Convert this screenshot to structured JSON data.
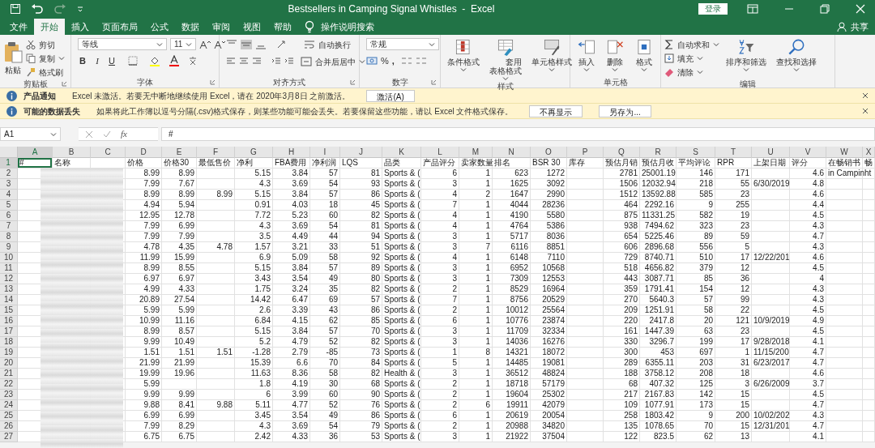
{
  "title_bar": {
    "title": "Bestsellers in Camping Signal Whistles  -  Excel",
    "sign_in": "登录"
  },
  "menu_tabs": [
    {
      "label": "文件",
      "selected": false
    },
    {
      "label": "开始",
      "selected": true
    },
    {
      "label": "插入",
      "selected": false
    },
    {
      "label": "页面布局",
      "selected": false
    },
    {
      "label": "公式",
      "selected": false
    },
    {
      "label": "数据",
      "selected": false
    },
    {
      "label": "审阅",
      "selected": false
    },
    {
      "label": "视图",
      "selected": false
    },
    {
      "label": "帮助",
      "selected": false
    }
  ],
  "tell_me": "操作说明搜索",
  "share": "共享",
  "ribbon": {
    "clipboard": {
      "paste": "粘贴",
      "cut": "剪切",
      "copy": "复制",
      "format_painter": "格式刷",
      "label": "剪贴板"
    },
    "font": {
      "font_name": "等线",
      "font_size": "11",
      "bold": "B",
      "italic": "I",
      "underline": "U",
      "label": "字体"
    },
    "alignment": {
      "wrap_text": "自动换行",
      "merge_center": "合并后居中",
      "label": "对齐方式"
    },
    "number": {
      "format": "常规",
      "percent": "%",
      "comma": ",",
      "label": "数字"
    },
    "styles": {
      "buttons": [
        "条件格式",
        "套用表格格式",
        "单元格样式"
      ],
      "label": "样式"
    },
    "cells": {
      "buttons": [
        "插入",
        "删除",
        "格式"
      ],
      "label": "单元格"
    },
    "editing": {
      "autosum": "自动求和",
      "fill": "填充",
      "clear": "清除",
      "sort": "排序和筛选",
      "find": "查找和选择",
      "label": "编辑"
    }
  },
  "notifications": [
    {
      "title": "产品通知",
      "message": "Excel 未激活。若要无中断地继续使用 Excel，请在 2020年3月8日 之前激活。",
      "buttons": [
        "激活(A)"
      ]
    },
    {
      "title": "可能的数据丢失",
      "message": "如果将此工作簿以逗号分隔(.csv)格式保存，则某些功能可能会丢失。若要保留这些功能，请以 Excel 文件格式保存。",
      "buttons": [
        "不再显示",
        "另存为..."
      ]
    }
  ],
  "formula_bar": {
    "name_box": "A1",
    "fx": "fx",
    "formula": "#"
  },
  "columns": [
    {
      "letter": "A",
      "kind": "text",
      "selected": true
    },
    {
      "letter": "B",
      "kind": "text",
      "selected": false
    },
    {
      "letter": "C",
      "kind": "text",
      "selected": false
    },
    {
      "letter": "D",
      "kind": "number",
      "selected": false
    },
    {
      "letter": "E",
      "kind": "number",
      "selected": false
    },
    {
      "letter": "F",
      "kind": "number",
      "selected": false
    },
    {
      "letter": "G",
      "kind": "number",
      "selected": false
    },
    {
      "letter": "H",
      "kind": "number",
      "selected": false
    },
    {
      "letter": "I",
      "kind": "number",
      "selected": false
    },
    {
      "letter": "J",
      "kind": "number",
      "selected": false
    },
    {
      "letter": "K",
      "kind": "text",
      "selected": false
    },
    {
      "letter": "L",
      "kind": "number",
      "selected": false
    },
    {
      "letter": "M",
      "kind": "number",
      "selected": false
    },
    {
      "letter": "N",
      "kind": "number",
      "selected": false
    },
    {
      "letter": "O",
      "kind": "number",
      "selected": false
    },
    {
      "letter": "P",
      "kind": "number",
      "selected": false
    },
    {
      "letter": "Q",
      "kind": "number",
      "selected": false
    },
    {
      "letter": "R",
      "kind": "number",
      "selected": false
    },
    {
      "letter": "S",
      "kind": "number",
      "selected": false
    },
    {
      "letter": "T",
      "kind": "number",
      "selected": false
    },
    {
      "letter": "U",
      "kind": "text",
      "selected": false
    },
    {
      "letter": "V",
      "kind": "number",
      "selected": false
    },
    {
      "letter": "W",
      "kind": "text",
      "selected": false
    },
    {
      "letter": "X",
      "kind": "text",
      "selected": false
    }
  ],
  "rows": [
    {
      "number": "1",
      "kind": "header",
      "selected": true,
      "cells": [
        "#",
        "名称",
        null,
        "价格",
        "价格30",
        "最低售价",
        "净利",
        "FBA费用",
        "净利润",
        "LQS",
        "品类",
        "产品评分",
        "卖家数量",
        "排名",
        "BSR 30",
        "库存",
        "预估月销",
        "预估月收",
        "平均评论",
        "RPR",
        "上架日期",
        "评分",
        "在畅销书",
        "畅"
      ]
    },
    {
      "number": "2",
      "kind": "data",
      "selected": false,
      "cells": [
        null,
        null,
        null,
        "8.99",
        "8.99",
        null,
        "5.15",
        "3.84",
        "57",
        "81",
        "Sports & (",
        "6",
        "1",
        "623",
        "1272",
        null,
        "2781",
        "25001.19",
        "146",
        "171",
        null,
        "4.6",
        "in Campin",
        "ht"
      ]
    },
    {
      "number": "3",
      "kind": "data",
      "selected": false,
      "cells": [
        null,
        null,
        null,
        "7.99",
        "7.67",
        null,
        "4.3",
        "3.69",
        "54",
        "93",
        "Sports & (",
        "3",
        "1",
        "1625",
        "3092",
        null,
        "1506",
        "12032.94",
        "218",
        "55",
        "6/30/2019",
        "4.8",
        null,
        null
      ]
    },
    {
      "number": "4",
      "kind": "data",
      "selected": false,
      "cells": [
        null,
        null,
        null,
        "8.99",
        "8.99",
        "8.99",
        "5.15",
        "3.84",
        "57",
        "86",
        "Sports & (",
        "4",
        "2",
        "1647",
        "2990",
        null,
        "1512",
        "13592.88",
        "585",
        "23",
        null,
        "4.6",
        null,
        null
      ]
    },
    {
      "number": "5",
      "kind": "data",
      "selected": false,
      "cells": [
        null,
        null,
        null,
        "4.94",
        "5.94",
        null,
        "0.91",
        "4.03",
        "18",
        "45",
        "Sports & (",
        "7",
        "1",
        "4044",
        "28236",
        null,
        "464",
        "2292.16",
        "9",
        "255",
        null,
        "4.4",
        null,
        null
      ]
    },
    {
      "number": "6",
      "kind": "data",
      "selected": false,
      "cells": [
        null,
        null,
        null,
        "12.95",
        "12.78",
        null,
        "7.72",
        "5.23",
        "60",
        "82",
        "Sports & (",
        "4",
        "1",
        "4190",
        "5580",
        null,
        "875",
        "11331.25",
        "582",
        "19",
        null,
        "4.5",
        null,
        null
      ]
    },
    {
      "number": "7",
      "kind": "data",
      "selected": false,
      "cells": [
        null,
        null,
        null,
        "7.99",
        "6.99",
        null,
        "4.3",
        "3.69",
        "54",
        "81",
        "Sports & (",
        "4",
        "1",
        "4764",
        "5386",
        null,
        "938",
        "7494.62",
        "323",
        "23",
        null,
        "4.3",
        null,
        null
      ]
    },
    {
      "number": "8",
      "kind": "data",
      "selected": false,
      "cells": [
        null,
        null,
        null,
        "7.99",
        "7.99",
        null,
        "3.5",
        "4.49",
        "44",
        "94",
        "Sports & (",
        "3",
        "1",
        "5717",
        "8036",
        null,
        "654",
        "5225.46",
        "89",
        "59",
        null,
        "4.7",
        null,
        null
      ]
    },
    {
      "number": "9",
      "kind": "data",
      "selected": false,
      "cells": [
        null,
        null,
        null,
        "4.78",
        "4.35",
        "4.78",
        "1.57",
        "3.21",
        "33",
        "51",
        "Sports & (",
        "3",
        "7",
        "6116",
        "8851",
        null,
        "606",
        "2896.68",
        "556",
        "5",
        null,
        "4.3",
        null,
        null
      ]
    },
    {
      "number": "10",
      "kind": "data",
      "selected": false,
      "cells": [
        null,
        null,
        null,
        "11.99",
        "15.99",
        null,
        "6.9",
        "5.09",
        "58",
        "92",
        "Sports & (",
        "4",
        "1",
        "6148",
        "7110",
        null,
        "729",
        "8740.71",
        "510",
        "17",
        "12/22/201",
        "4.6",
        null,
        null
      ]
    },
    {
      "number": "11",
      "kind": "data",
      "selected": false,
      "cells": [
        null,
        null,
        null,
        "8.99",
        "8.55",
        null,
        "5.15",
        "3.84",
        "57",
        "89",
        "Sports & (",
        "3",
        "1",
        "6952",
        "10568",
        null,
        "518",
        "4656.82",
        "379",
        "12",
        null,
        "4.5",
        null,
        null
      ]
    },
    {
      "number": "12",
      "kind": "data",
      "selected": false,
      "cells": [
        null,
        null,
        null,
        "6.97",
        "6.97",
        null,
        "3.43",
        "3.54",
        "49",
        "80",
        "Sports & (",
        "3",
        "1",
        "7309",
        "12553",
        null,
        "443",
        "3087.71",
        "85",
        "36",
        null,
        "4",
        null,
        null
      ]
    },
    {
      "number": "13",
      "kind": "data",
      "selected": false,
      "cells": [
        null,
        null,
        null,
        "4.99",
        "4.33",
        null,
        "1.75",
        "3.24",
        "35",
        "82",
        "Sports & (",
        "2",
        "1",
        "8529",
        "16964",
        null,
        "359",
        "1791.41",
        "154",
        "12",
        null,
        "4.3",
        null,
        null
      ]
    },
    {
      "number": "14",
      "kind": "data",
      "selected": false,
      "cells": [
        null,
        null,
        null,
        "20.89",
        "27.54",
        null,
        "14.42",
        "6.47",
        "69",
        "57",
        "Sports & (",
        "7",
        "1",
        "8756",
        "20529",
        null,
        "270",
        "5640.3",
        "57",
        "99",
        null,
        "4.3",
        null,
        null
      ]
    },
    {
      "number": "15",
      "kind": "data",
      "selected": false,
      "cells": [
        null,
        null,
        null,
        "5.99",
        "5.99",
        null,
        "2.6",
        "3.39",
        "43",
        "86",
        "Sports & (",
        "2",
        "1",
        "10012",
        "25564",
        null,
        "209",
        "1251.91",
        "58",
        "22",
        null,
        "4.5",
        null,
        null
      ]
    },
    {
      "number": "16",
      "kind": "data",
      "selected": false,
      "cells": [
        null,
        null,
        null,
        "10.99",
        "11.16",
        null,
        "6.84",
        "4.15",
        "62",
        "85",
        "Sports & (",
        "6",
        "1",
        "10776",
        "23874",
        null,
        "220",
        "2417.8",
        "20",
        "121",
        "10/9/2019",
        "4.9",
        null,
        null
      ]
    },
    {
      "number": "17",
      "kind": "data",
      "selected": false,
      "cells": [
        null,
        null,
        null,
        "8.99",
        "8.57",
        null,
        "5.15",
        "3.84",
        "57",
        "70",
        "Sports & (",
        "3",
        "1",
        "11709",
        "32334",
        null,
        "161",
        "1447.39",
        "63",
        "23",
        null,
        "4.5",
        null,
        null
      ]
    },
    {
      "number": "18",
      "kind": "data",
      "selected": false,
      "cells": [
        null,
        null,
        null,
        "9.99",
        "10.49",
        null,
        "5.2",
        "4.79",
        "52",
        "82",
        "Sports & (",
        "3",
        "1",
        "14036",
        "16276",
        null,
        "330",
        "3296.7",
        "199",
        "17",
        "9/28/2018",
        "4.1",
        null,
        null
      ]
    },
    {
      "number": "19",
      "kind": "data",
      "selected": false,
      "cells": [
        null,
        null,
        null,
        "1.51",
        "1.51",
        "1.51",
        "-1.28",
        "2.79",
        "-85",
        "73",
        "Sports & (",
        "1",
        "8",
        "14321",
        "18072",
        null,
        "300",
        "453",
        "697",
        "1",
        "11/15/200",
        "4.7",
        null,
        null
      ]
    },
    {
      "number": "20",
      "kind": "data",
      "selected": false,
      "cells": [
        null,
        null,
        null,
        "21.99",
        "21.99",
        null,
        "15.39",
        "6.6",
        "70",
        "84",
        "Sports & (",
        "5",
        "1",
        "14485",
        "19081",
        null,
        "289",
        "6355.11",
        "203",
        "31",
        "6/23/2017",
        "4.7",
        null,
        null
      ]
    },
    {
      "number": "21",
      "kind": "data",
      "selected": false,
      "cells": [
        null,
        null,
        null,
        "19.99",
        "19.96",
        null,
        "11.63",
        "8.36",
        "58",
        "82",
        "Health & (",
        "3",
        "1",
        "36512",
        "48824",
        null,
        "188",
        "3758.12",
        "208",
        "18",
        null,
        "4.6",
        null,
        null
      ]
    },
    {
      "number": "22",
      "kind": "data",
      "selected": false,
      "cells": [
        null,
        null,
        null,
        "5.99",
        null,
        null,
        "1.8",
        "4.19",
        "30",
        "68",
        "Sports & (",
        "2",
        "1",
        "18718",
        "57179",
        null,
        "68",
        "407.32",
        "125",
        "3",
        "6/26/2009",
        "3.7",
        null,
        null
      ]
    },
    {
      "number": "23",
      "kind": "data",
      "selected": false,
      "cells": [
        null,
        null,
        null,
        "9.99",
        "9.99",
        null,
        "6",
        "3.99",
        "60",
        "90",
        "Sports & (",
        "2",
        "1",
        "19604",
        "25302",
        null,
        "217",
        "2167.83",
        "142",
        "15",
        null,
        "4.5",
        null,
        null
      ]
    },
    {
      "number": "24",
      "kind": "data",
      "selected": false,
      "cells": [
        null,
        null,
        null,
        "9.88",
        "8.41",
        "9.88",
        "5.11",
        "4.77",
        "52",
        "76",
        "Sports & (",
        "2",
        "6",
        "19911",
        "42079",
        null,
        "109",
        "1077.91",
        "173",
        "15",
        null,
        "4.7",
        null,
        null
      ]
    },
    {
      "number": "25",
      "kind": "data",
      "selected": false,
      "cells": [
        null,
        null,
        null,
        "6.99",
        "6.99",
        null,
        "3.45",
        "3.54",
        "49",
        "86",
        "Sports & (",
        "6",
        "1",
        "20619",
        "20054",
        null,
        "258",
        "1803.42",
        "9",
        "200",
        "10/02/202",
        "4.3",
        null,
        null
      ]
    },
    {
      "number": "26",
      "kind": "data",
      "selected": false,
      "cells": [
        null,
        null,
        null,
        "7.99",
        "8.29",
        null,
        "4.3",
        "3.69",
        "54",
        "79",
        "Sports & (",
        "2",
        "1",
        "20988",
        "34820",
        null,
        "135",
        "1078.65",
        "70",
        "15",
        "12/31/201",
        "4.7",
        null,
        null
      ]
    },
    {
      "number": "27",
      "kind": "data",
      "selected": false,
      "cells": [
        null,
        null,
        null,
        "6.75",
        "6.75",
        null,
        "2.42",
        "4.33",
        "36",
        "53",
        "Sports & (",
        "3",
        "1",
        "21922",
        "37504",
        null,
        "122",
        "823.5",
        "62",
        "13",
        null,
        "4.1",
        null,
        null
      ]
    }
  ]
}
